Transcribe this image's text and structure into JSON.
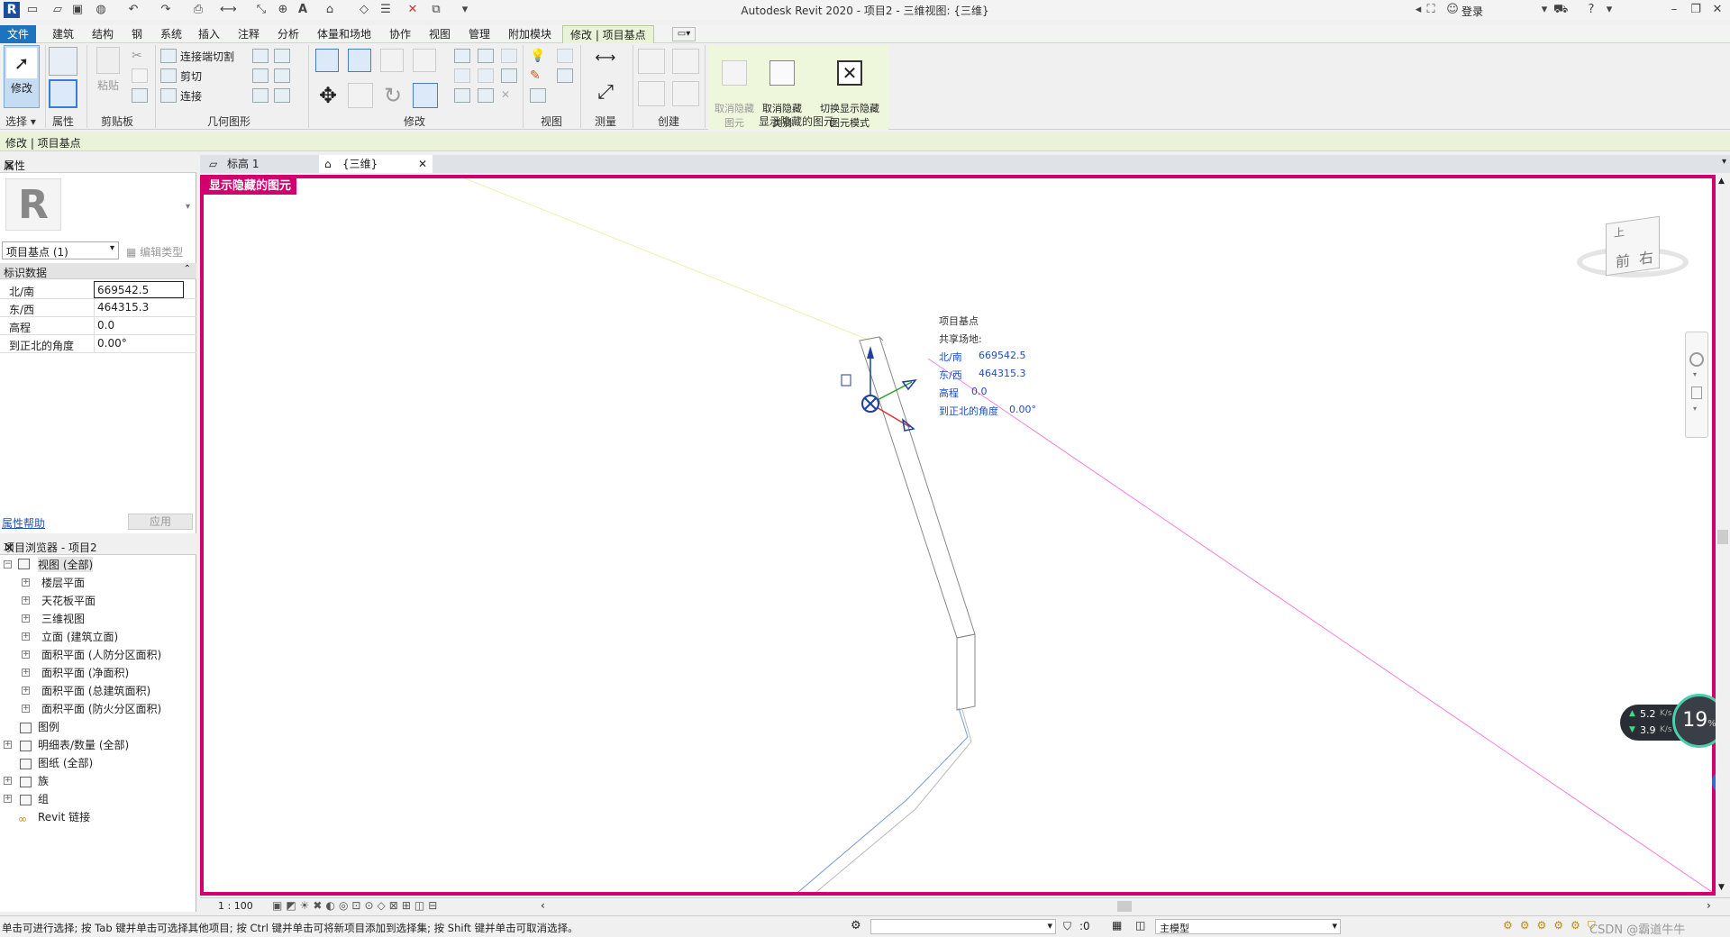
{
  "window": {
    "title": "Autodesk Revit 2020 - 项目2 - 三维视图: {三维}",
    "login_label": "登录"
  },
  "ribbon_tabs": [
    {
      "label": "文件"
    },
    {
      "label": "建筑"
    },
    {
      "label": "结构"
    },
    {
      "label": "钢"
    },
    {
      "label": "系统"
    },
    {
      "label": "插入"
    },
    {
      "label": "注释"
    },
    {
      "label": "分析"
    },
    {
      "label": "体量和场地"
    },
    {
      "label": "协作"
    },
    {
      "label": "视图"
    },
    {
      "label": "管理"
    },
    {
      "label": "附加模块"
    },
    {
      "label": "修改 | 项目基点"
    }
  ],
  "ribbon": {
    "modify_label": "修改",
    "paste_label": "粘贴",
    "connect_cut_label": "连接端切割",
    "cut_label": "剪切",
    "join_label": "连接",
    "unhide_element_label": "取消隐藏\n图元",
    "unhide_category_label": "取消隐藏\n类别",
    "toggle_reveal_label": "切换显示隐藏\n图元模式",
    "panels": {
      "select": "选择",
      "properties": "属性",
      "clipboard": "剪贴板",
      "geometry": "几何图形",
      "modify": "修改",
      "view": "视图",
      "measure": "测量",
      "create": "创建",
      "reveal_hidden": "显示隐藏的图元"
    }
  },
  "context_bar": {
    "text": "修改 | 项目基点"
  },
  "properties": {
    "title": "属性",
    "type_selector": "项目基点 (1)",
    "edit_type_label": "编辑类型",
    "section": "标识数据",
    "rows": [
      {
        "key": "北/南",
        "value": "669542.5"
      },
      {
        "key": "东/西",
        "value": "464315.3"
      },
      {
        "key": "高程",
        "value": "0.0"
      },
      {
        "key": "到正北的角度",
        "value": "0.00°"
      }
    ],
    "help_link": "属性帮助",
    "apply_label": "应用"
  },
  "browser": {
    "title": "项目浏览器 - 项目2",
    "items": [
      {
        "label": "视图 (全部)"
      },
      {
        "label": "楼层平面"
      },
      {
        "label": "天花板平面"
      },
      {
        "label": "三维视图"
      },
      {
        "label": "立面 (建筑立面)"
      },
      {
        "label": "面积平面 (人防分区面积)"
      },
      {
        "label": "面积平面 (净面积)"
      },
      {
        "label": "面积平面 (总建筑面积)"
      },
      {
        "label": "面积平面 (防火分区面积)"
      },
      {
        "label": "图例"
      },
      {
        "label": "明细表/数量 (全部)"
      },
      {
        "label": "图纸 (全部)"
      },
      {
        "label": "族"
      },
      {
        "label": "组"
      },
      {
        "label": "Revit 链接"
      }
    ]
  },
  "view_tabs": [
    {
      "label": "标高 1"
    },
    {
      "label": "{三维}"
    }
  ],
  "canvas": {
    "hidden_badge": "显示隐藏的图元",
    "viewcube_front": "前",
    "viewcube_right": "右",
    "viewcube_top": "上",
    "annotation": {
      "title": "项目基点",
      "shared_site": "共享场地:",
      "ns_label": "北/南",
      "ns_value": "669542.5",
      "ew_label": "东/西",
      "ew_value": "464315.3",
      "elev_label": "高程",
      "elev_value": "0.0",
      "angle_label": "到正北的角度",
      "angle_value": "0.00°"
    },
    "net_up": "5.2",
    "net_down": "3.9",
    "net_unit": "K/s",
    "cpu_percent": "19",
    "cpu_unit": "%"
  },
  "view_control": {
    "scale": "1 : 100"
  },
  "status": {
    "message": "单击可进行选择; 按 Tab 键并单击可选择其他项目; 按 Ctrl 键并单击可将新项目添加到选择集; 按 Shift 键并单击可取消选择。",
    "workset_value": ":0",
    "model_value": "主模型",
    "watermark": "CSDN @霸道牛牛"
  }
}
